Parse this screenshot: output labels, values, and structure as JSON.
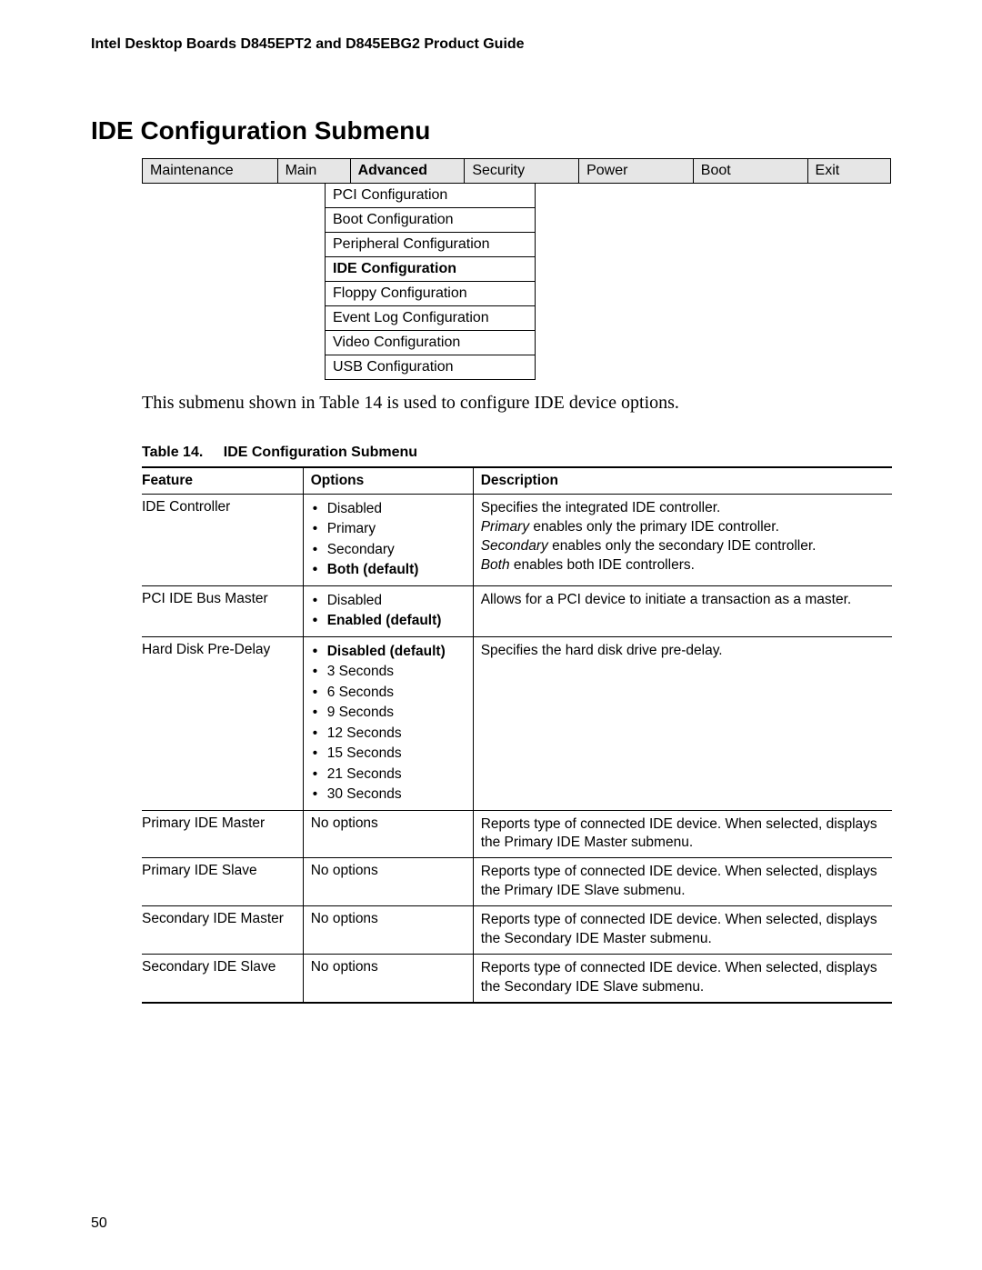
{
  "running_header": "Intel Desktop Boards D845EPT2 and D845EBG2 Product Guide",
  "section_title": "IDE Configuration Submenu",
  "page_number": "50",
  "menu_tabs": [
    {
      "label": "Maintenance",
      "active": false
    },
    {
      "label": "Main",
      "active": false
    },
    {
      "label": "Advanced",
      "active": true
    },
    {
      "label": "Security",
      "active": false
    },
    {
      "label": "Power",
      "active": false
    },
    {
      "label": "Boot",
      "active": false
    },
    {
      "label": "Exit",
      "active": false
    }
  ],
  "submenu_items": [
    {
      "label": "PCI Configuration",
      "active": false
    },
    {
      "label": "Boot Configuration",
      "active": false
    },
    {
      "label": "Peripheral Configuration",
      "active": false
    },
    {
      "label": "IDE Configuration",
      "active": true
    },
    {
      "label": "Floppy  Configuration",
      "active": false
    },
    {
      "label": "Event Log Configuration",
      "active": false
    },
    {
      "label": "Video Configuration",
      "active": false
    },
    {
      "label": "USB Configuration",
      "active": false
    }
  ],
  "intro_text": "This submenu shown in Table 14 is used to configure IDE device options.",
  "table_caption_num": "Table 14.",
  "table_caption_title": "IDE Configuration Submenu",
  "table_headers": {
    "feature": "Feature",
    "options": "Options",
    "description": "Description"
  },
  "rows": [
    {
      "feature": "IDE Controller",
      "options": [
        {
          "text": "Disabled",
          "default": false
        },
        {
          "text": "Primary",
          "default": false
        },
        {
          "text": "Secondary",
          "default": false
        },
        {
          "text": "Both (default)",
          "default": true
        }
      ],
      "no_options_text": "",
      "description_html": "Specifies the integrated IDE controller.<br><span class=\"em\">Primary</span> enables only the primary IDE controller.<br><span class=\"em\">Secondary</span> enables only the secondary IDE controller.<br><span class=\"em\">Both</span> enables both IDE controllers."
    },
    {
      "feature": "PCI IDE Bus Master",
      "options": [
        {
          "text": "Disabled",
          "default": false
        },
        {
          "text": "Enabled (default)",
          "default": true
        }
      ],
      "no_options_text": "",
      "description_html": "Allows for a PCI device to initiate a transaction as a master."
    },
    {
      "feature": "Hard Disk Pre-Delay",
      "options": [
        {
          "text": "Disabled (default)",
          "default": true
        },
        {
          "text": "3 Seconds",
          "default": false
        },
        {
          "text": "6 Seconds",
          "default": false
        },
        {
          "text": "9 Seconds",
          "default": false
        },
        {
          "text": "12 Seconds",
          "default": false
        },
        {
          "text": "15 Seconds",
          "default": false
        },
        {
          "text": "21 Seconds",
          "default": false
        },
        {
          "text": "30 Seconds",
          "default": false
        }
      ],
      "no_options_text": "",
      "description_html": "Specifies the hard disk drive pre-delay."
    },
    {
      "feature": "Primary IDE Master",
      "options": [],
      "no_options_text": "No options",
      "description_html": "Reports type of connected IDE device.  When selected, displays the Primary IDE Master submenu."
    },
    {
      "feature": "Primary IDE Slave",
      "options": [],
      "no_options_text": "No options",
      "description_html": "Reports type of connected IDE device.  When selected, displays the Primary IDE Slave submenu."
    },
    {
      "feature": "Secondary IDE Master",
      "options": [],
      "no_options_text": "No options",
      "description_html": "Reports type of connected IDE device.  When selected, displays the Secondary IDE Master submenu."
    },
    {
      "feature": "Secondary IDE Slave",
      "options": [],
      "no_options_text": "No options",
      "description_html": "Reports type of connected IDE device.  When selected, displays the Secondary IDE Slave submenu."
    }
  ]
}
